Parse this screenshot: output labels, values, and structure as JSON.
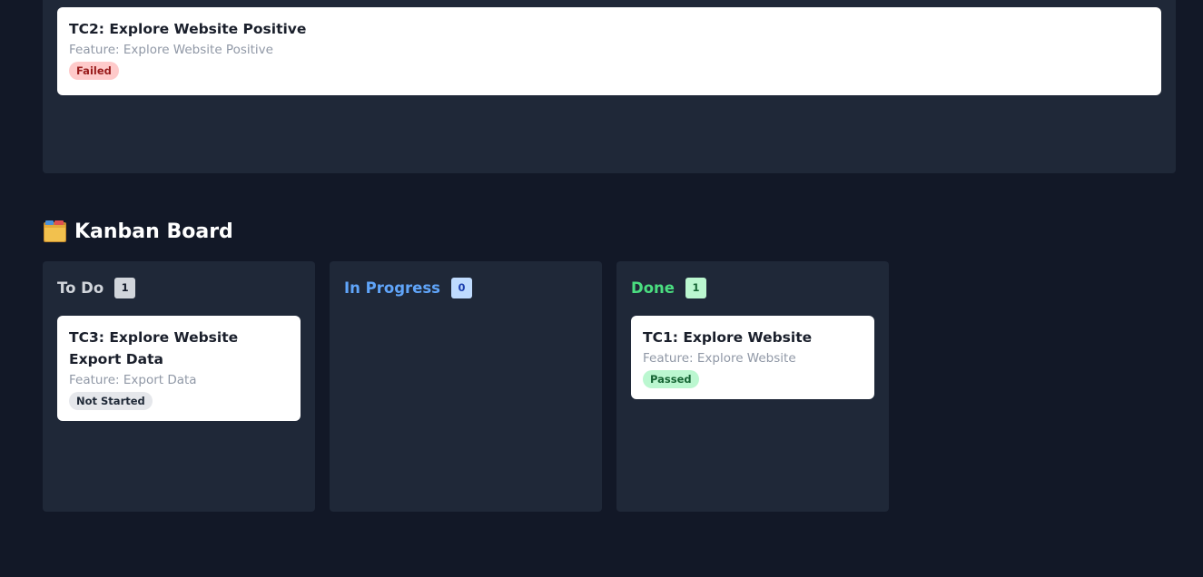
{
  "top_card": {
    "title": "TC2: Explore Website Positive",
    "feature": "Feature: Explore Website Positive",
    "status": "Failed"
  },
  "board": {
    "title": "Kanban Board",
    "icon": "card-index-dividers-icon",
    "columns": [
      {
        "name": "To Do",
        "count": "1",
        "color": "#d1d5db",
        "count_bg": "#d1d5db",
        "count_fg": "#111827",
        "cards": [
          {
            "title": "TC3: Explore Website Export Data",
            "feature": "Feature: Export Data",
            "status": "Not Started"
          }
        ]
      },
      {
        "name": "In Progress",
        "count": "0",
        "color": "#60a5fa",
        "count_bg": "#bfdbfe",
        "count_fg": "#1e40af",
        "cards": []
      },
      {
        "name": "Done",
        "count": "1",
        "color": "#4ade80",
        "count_bg": "#bbf7d0",
        "count_fg": "#166534",
        "cards": [
          {
            "title": "TC1: Explore Website",
            "feature": "Feature: Explore Website",
            "status": "Passed"
          }
        ]
      }
    ]
  }
}
